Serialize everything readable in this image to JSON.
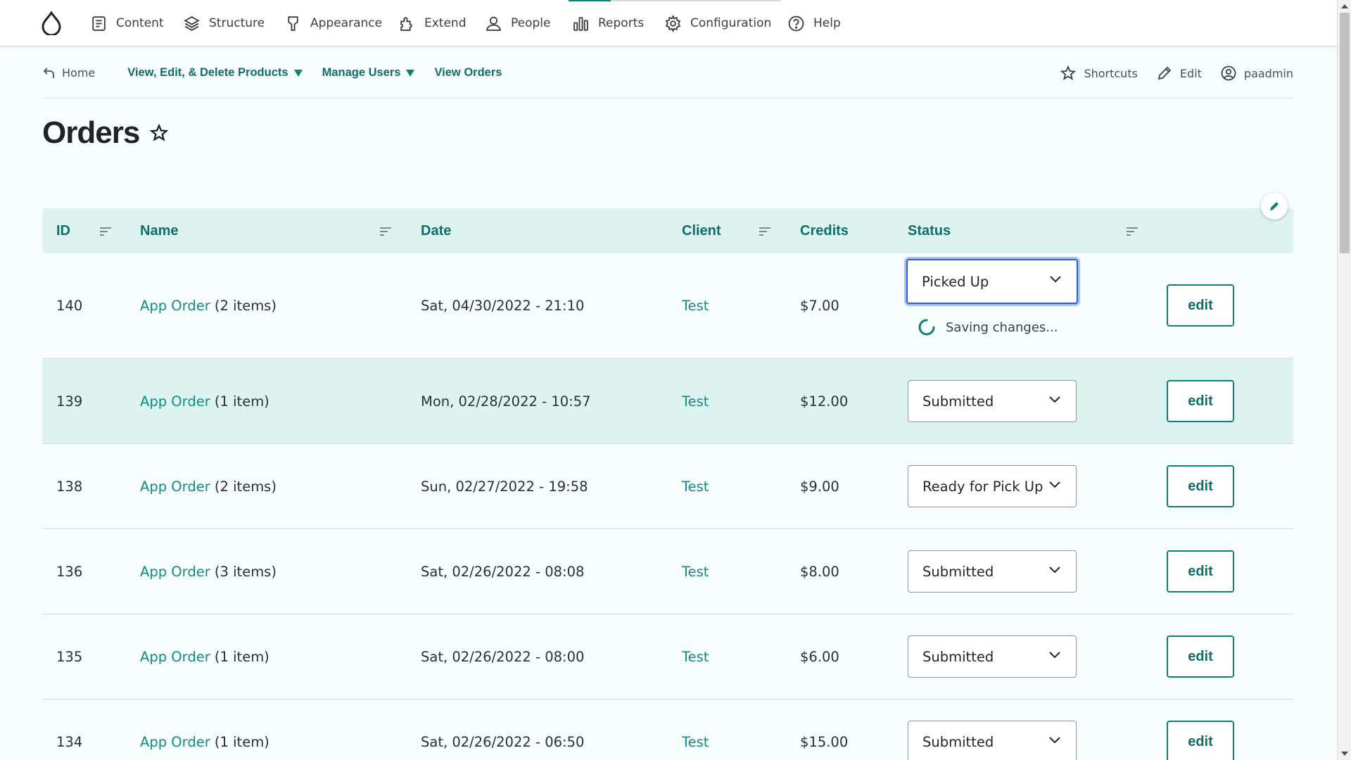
{
  "toolbar": {
    "items": [
      {
        "label": "Content",
        "icon": "content-icon"
      },
      {
        "label": "Structure",
        "icon": "structure-icon"
      },
      {
        "label": "Appearance",
        "icon": "appearance-icon"
      },
      {
        "label": "Extend",
        "icon": "extend-icon"
      },
      {
        "label": "People",
        "icon": "people-icon"
      },
      {
        "label": "Reports",
        "icon": "reports-icon"
      },
      {
        "label": "Configuration",
        "icon": "gear-icon"
      },
      {
        "label": "Help",
        "icon": "help-icon"
      }
    ]
  },
  "subnav": {
    "home": "Home",
    "links": [
      "View, Edit, & Delete Products",
      "Manage Users",
      "View Orders"
    ],
    "shortcuts": "Shortcuts",
    "edit": "Edit",
    "user": "paadmin"
  },
  "page": {
    "title": "Orders"
  },
  "table": {
    "headers": {
      "id": "ID",
      "name": "Name",
      "date": "Date",
      "client": "Client",
      "credits": "Credits",
      "status": "Status"
    },
    "rows": [
      {
        "id": "140",
        "name_link": "App Order",
        "name_suffix": " (2 items)",
        "date": "Sat, 04/30/2022 - 21:10",
        "client": "Test",
        "credits": "$7.00",
        "status": "Picked Up",
        "action": "edit",
        "saving": "Saving changes..."
      },
      {
        "id": "139",
        "name_link": "App Order",
        "name_suffix": " (1 item)",
        "date": "Mon, 02/28/2022 - 10:57",
        "client": "Test",
        "credits": "$12.00",
        "status": "Submitted",
        "action": "edit"
      },
      {
        "id": "138",
        "name_link": "App Order",
        "name_suffix": " (2 items)",
        "date": "Sun, 02/27/2022 - 19:58",
        "client": "Test",
        "credits": "$9.00",
        "status": "Ready for Pick Up",
        "action": "edit"
      },
      {
        "id": "136",
        "name_link": "App Order",
        "name_suffix": " (3 items)",
        "date": "Sat, 02/26/2022 - 08:08",
        "client": "Test",
        "credits": "$8.00",
        "status": "Submitted",
        "action": "edit"
      },
      {
        "id": "135",
        "name_link": "App Order",
        "name_suffix": " (1 item)",
        "date": "Sat, 02/26/2022 - 08:00",
        "client": "Test",
        "credits": "$6.00",
        "status": "Submitted",
        "action": "edit"
      },
      {
        "id": "134",
        "name_link": "App Order",
        "name_suffix": " (1 item)",
        "date": "Sat, 02/26/2022 - 06:50",
        "client": "Test",
        "credits": "$15.00",
        "status": "Submitted",
        "action": "edit"
      }
    ]
  },
  "colors": {
    "accent": "#0e7f78",
    "header_bg": "#dcf3f0",
    "focus": "#2a5fd1"
  }
}
